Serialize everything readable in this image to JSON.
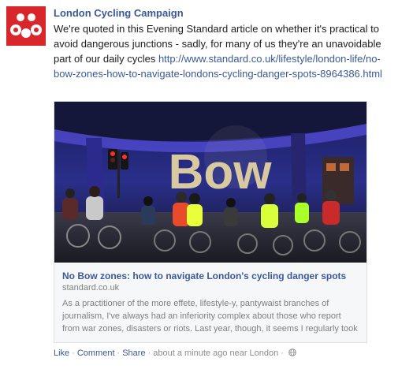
{
  "post": {
    "author": "London Cycling Campaign",
    "message": "We're quoted in this Evening Standard article on whether it's practical to avoid dangerous junctions - sadly, for many of us they're an unavoidable part of our daily cycles ",
    "message_link": "http://www.standard.co.uk/lifestyle/london-life/no-bow-zones-how-to-navigate-londons-cycling-danger-spots-8964386.html"
  },
  "attachment": {
    "photo_text": "Bow",
    "title": "No Bow zones: how to navigate London's cycling danger spots",
    "domain": "standard.co.uk",
    "description": "As a practitioner of the more effete, lifestyle-y, pantywaist branches of journalism, I've always had an inferiority complex about those who report from war zones, disasters or riots. Last year, though, it seems I regularly took my"
  },
  "actions": {
    "like": "Like",
    "comment": "Comment",
    "share": "Share",
    "separator": "·",
    "time": "about a minute ago near London",
    "privacy_icon": "globe-icon"
  },
  "colors": {
    "brand_red": "#d8262b",
    "link_blue": "#3b5998",
    "muted_gray": "#7f7f7f"
  }
}
